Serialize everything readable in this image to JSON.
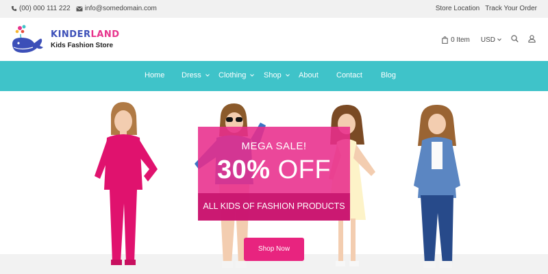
{
  "topbar": {
    "phone": "(00) 000 111 222",
    "email": "info@somedomain.com",
    "links": [
      "Store Location",
      "Track Your Order"
    ]
  },
  "logo": {
    "brand_part1": "KINDER",
    "brand_part2": "LAND",
    "tagline": "Kids Fashion Store"
  },
  "header": {
    "cart_label": "0 Item",
    "currency": "USD"
  },
  "nav": {
    "items": [
      {
        "label": "Home",
        "dropdown": false
      },
      {
        "label": "Dress",
        "dropdown": true
      },
      {
        "label": "Clothing",
        "dropdown": true
      },
      {
        "label": "Shop",
        "dropdown": true
      },
      {
        "label": "About",
        "dropdown": false
      },
      {
        "label": "Contact",
        "dropdown": false
      },
      {
        "label": "Blog",
        "dropdown": false
      }
    ]
  },
  "hero": {
    "headline": "MEGA SALE!",
    "discount_number": "30%",
    "discount_word": "OFF",
    "subline": "ALL KIDS OF FASHION PRODUCTS",
    "cta_label": "Shop Now"
  },
  "colors": {
    "accent_teal": "#3fc3c9",
    "accent_pink": "#e8247f",
    "brand_blue": "#3c4fb8",
    "brand_pink": "#e7338c"
  },
  "icons": [
    "phone-icon",
    "envelope-icon",
    "whale-logo-icon",
    "bag-icon",
    "chevron-down-icon",
    "search-icon",
    "user-icon"
  ]
}
